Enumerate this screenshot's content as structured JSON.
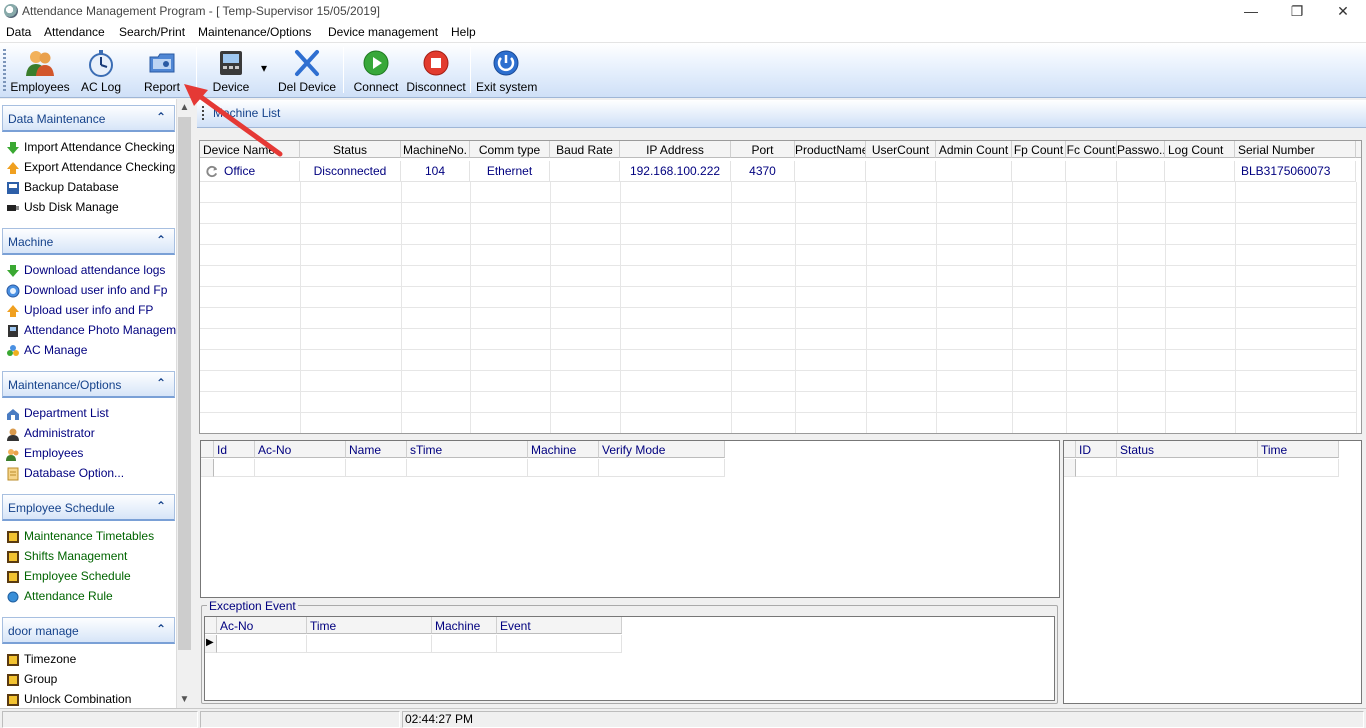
{
  "window": {
    "title": "Attendance Management Program - [ Temp-Supervisor 15/05/2019]",
    "minimize": "—",
    "restore": "❐",
    "close": "✕"
  },
  "menu": [
    "Data",
    "Attendance",
    "Search/Print",
    "Maintenance/Options",
    "Device management",
    "Help"
  ],
  "toolbar": {
    "employees": "Employees",
    "ac_log": "AC Log",
    "report": "Report",
    "device": "Device",
    "device_dropdown": "▾",
    "del_device": "Del Device",
    "connect": "Connect",
    "disconnect": "Disconnect",
    "exit": "Exit system"
  },
  "sidebar": {
    "scroll_up": "▲",
    "scroll_down": "▼",
    "chevron": "⌃",
    "groups": [
      {
        "title": "Data Maintenance",
        "items": [
          "Import Attendance Checking ...",
          "Export Attendance Checking ...",
          "Backup Database",
          "Usb Disk Manage"
        ]
      },
      {
        "title": "Machine",
        "items": [
          "Download attendance logs",
          "Download user info and Fp",
          "Upload user info and FP",
          "Attendance Photo Managem...",
          "AC Manage"
        ]
      },
      {
        "title": "Maintenance/Options",
        "items": [
          "Department List",
          "Administrator",
          "Employees",
          "Database Option..."
        ]
      },
      {
        "title": "Employee Schedule",
        "items": [
          "Maintenance Timetables",
          "Shifts Management",
          "Employee Schedule",
          "Attendance Rule"
        ]
      },
      {
        "title": "door manage",
        "items": [
          "Timezone",
          "Group",
          "Unlock Combination"
        ]
      }
    ]
  },
  "machine_list": {
    "title": "Machine List",
    "columns": [
      "Device Name",
      "Status",
      "MachineNo.",
      "Comm type",
      "Baud Rate",
      "IP Address",
      "Port",
      "ProductName",
      "UserCount",
      "Admin Count",
      "Fp Count",
      "Fc Count",
      "Passwo...",
      "Log Count",
      "Serial Number"
    ],
    "rows": [
      [
        "Office",
        "Disconnected",
        "104",
        "Ethernet",
        "",
        "192.168.100.222",
        "4370",
        "",
        "",
        "",
        "",
        "",
        "",
        "",
        "BLB3175060073"
      ]
    ]
  },
  "log_grid": {
    "columns": [
      "Id",
      "Ac-No",
      "Name",
      "sTime",
      "Machine",
      "Verify Mode"
    ]
  },
  "status_grid": {
    "columns": [
      "ID",
      "Status",
      "Time"
    ]
  },
  "exception": {
    "title": "Exception Event",
    "columns": [
      "Ac-No",
      "Time",
      "Machine",
      "Event"
    ],
    "row_marker": "▶"
  },
  "statusbar": {
    "time": "02:44:27 PM"
  },
  "colors": {
    "accent": "#15428b",
    "link_blue": "#00007f",
    "arrow_red": "#e53935"
  }
}
